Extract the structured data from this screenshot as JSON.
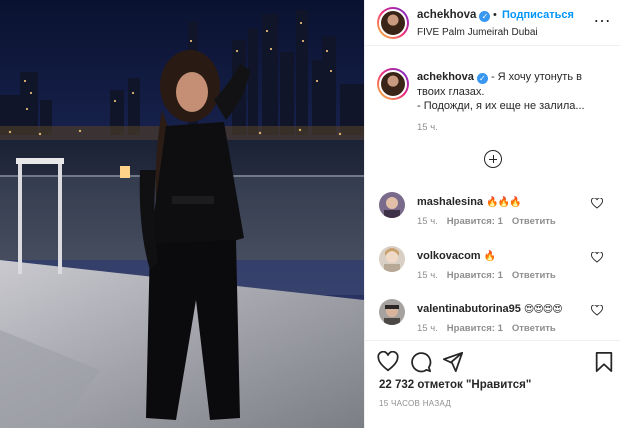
{
  "post": {
    "username": "achekhova",
    "verified_glyph": "✓",
    "separator": "•",
    "follow_label": "Подписаться",
    "location": "FIVE Palm Jumeirah Dubai",
    "more_label": "…"
  },
  "caption": {
    "username": "achekhova",
    "text_line1": "- Я хочу утонуть в",
    "text_line2": "твоих глазах.",
    "text_line3": "- Подожди, я их еще не залила...",
    "time": "15 ч."
  },
  "comments": [
    {
      "username": "mashalesina",
      "text": "🔥🔥🔥",
      "time": "15 ч.",
      "like": "Нравится: 1",
      "reply": "Ответить"
    },
    {
      "username": "volkovacom",
      "text": "🔥",
      "time": "15 ч.",
      "like": "Нравится: 1",
      "reply": "Ответить"
    },
    {
      "username": "valentinabutorina95",
      "text": "😍😍😍😍",
      "time": "15 ч.",
      "like": "Нравится: 1",
      "reply": "Ответить"
    }
  ],
  "footer": {
    "likes": "22 732 отметок \"Нравится\"",
    "ago": "15 часов назад"
  },
  "icons": {
    "more": "more-options-icon",
    "load_more": "load-more-comments-icon",
    "like": "heart-icon",
    "comment": "comment-icon",
    "share": "share-icon",
    "save": "bookmark-icon"
  },
  "colors": {
    "follow_blue": "#0095f6",
    "verified_blue": "#3897f0",
    "muted_text": "#8e8e8e",
    "primary_text": "#262626"
  }
}
